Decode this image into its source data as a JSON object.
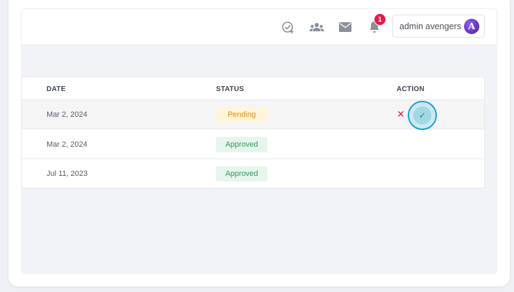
{
  "header": {
    "icons": [
      "task-check-icon",
      "team-icon",
      "mail-icon",
      "bell-icon"
    ],
    "notification_count": "1",
    "user_name": "admin avengers",
    "avatar_letter": "A"
  },
  "table": {
    "columns": [
      "DATE",
      "STATUS",
      "ACTION"
    ],
    "rows": [
      {
        "date": "Mar 2, 2024",
        "status": "Pending",
        "actions": [
          "reject",
          "approve"
        ]
      },
      {
        "date": "Mar 2, 2024",
        "status": "Approved",
        "actions": []
      },
      {
        "date": "Jul 11, 2023",
        "status": "Approved",
        "actions": []
      }
    ]
  },
  "actions": {
    "reject_glyph": "✕",
    "approve_glyph": "✓"
  },
  "colors": {
    "pending_bg": "#fff6d9",
    "pending_text": "#e08a0b",
    "approved_bg": "#e6f6ec",
    "approved_text": "#2e9a57",
    "badge": "#e11d48",
    "focus_ring": "#1a9fd8"
  }
}
